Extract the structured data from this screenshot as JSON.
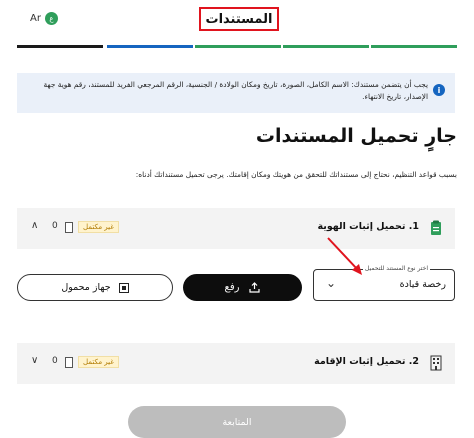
{
  "header": {
    "lang": "Ar",
    "title": "المستندات"
  },
  "progress_colors": [
    "#1a1a1a",
    "#1565c0",
    "#2f9e5b",
    "#2f9e5b",
    "#2f9e5b"
  ],
  "info": {
    "icon": "info-icon",
    "text": "يجب أن يتضمن مستندك: الاسم الكامل، الصورة، تاريخ ومكان الولادة / الجنسية، الرقم المرجعي الفريد للمستند، رقم هوية جهة الإصدار، تاريخ الانتهاء."
  },
  "main": {
    "heading": "جارٍ تحميل المستندات",
    "subtext": "بسبب قواعد التنظيم، نحتاج إلى مستنداتك للتحقق من هويتك ومكان إقامتك. يرجى تحميل مستنداتك أدناه:"
  },
  "sections": [
    {
      "title": "1. تحميل إثبات الهوية",
      "badge": "غير مكتمل",
      "count": "0",
      "chevron": "∧",
      "icon": "id-document-icon"
    },
    {
      "title": "2. تحميل إثبات الإقامة",
      "badge": "غير مكتمل",
      "count": "0",
      "chevron": "∨",
      "icon": "building-icon"
    }
  ],
  "upload": {
    "select_label": "اختر نوع المستند للتحميل",
    "select_value": "رخصة قيادة",
    "upload_button": "رفع",
    "mobile_button": "جهاز محمول"
  },
  "footer": {
    "continue_button": "المتابعة"
  }
}
